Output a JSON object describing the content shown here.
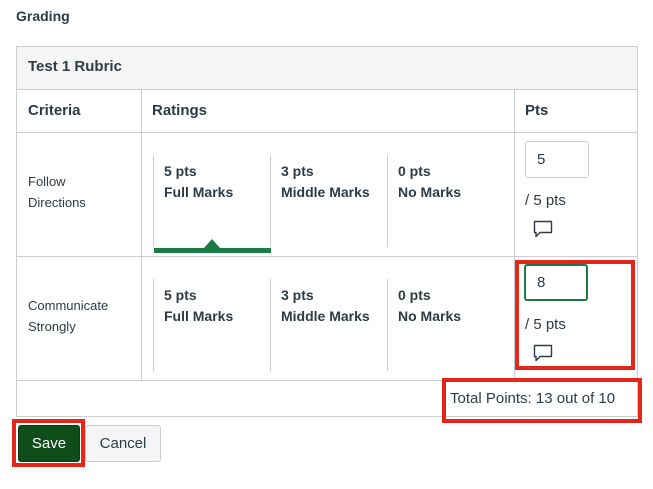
{
  "section": {
    "title": "Grading"
  },
  "rubric": {
    "title": "Test 1 Rubric",
    "headers": {
      "criteria": "Criteria",
      "ratings": "Ratings",
      "pts": "Pts"
    },
    "rows": [
      {
        "criterion_line1": "Follow",
        "criterion_line2": "Directions",
        "ratings": [
          {
            "pts": "5 pts",
            "desc": "Full Marks",
            "selected": true
          },
          {
            "pts": "3 pts",
            "desc": "Middle Marks",
            "selected": false
          },
          {
            "pts": "0 pts",
            "desc": "No Marks",
            "selected": false
          }
        ],
        "points_value": "5",
        "out_of": "/ 5 pts"
      },
      {
        "criterion_line1": "Communicate",
        "criterion_line2": "Strongly",
        "ratings": [
          {
            "pts": "5 pts",
            "desc": "Full Marks",
            "selected": false
          },
          {
            "pts": "3 pts",
            "desc": "Middle Marks",
            "selected": false
          },
          {
            "pts": "0 pts",
            "desc": "No Marks",
            "selected": false
          }
        ],
        "points_value": "8",
        "out_of": "/ 5 pts"
      }
    ],
    "total": "Total Points: 13 out of 10"
  },
  "actions": {
    "save_label": "Save",
    "cancel_label": "Cancel"
  },
  "colors": {
    "highlight": "#e5271b",
    "selected_rating": "#1b7b45",
    "save_button": "#0f4d1a"
  },
  "icons": {
    "comment": "comment-icon"
  }
}
